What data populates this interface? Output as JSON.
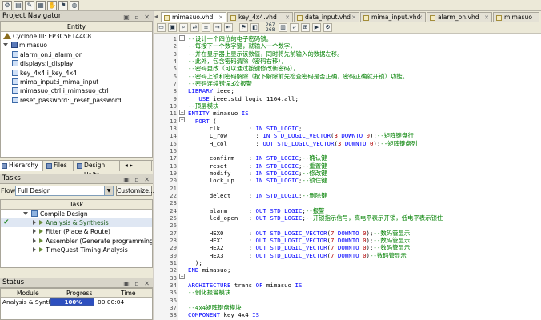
{
  "toolbar": {
    "buttons": [
      "gear-icon",
      "doc-icon",
      "note-icon",
      "grid-icon",
      "hand-icon",
      "flag-icon",
      "globe-icon"
    ]
  },
  "project_navigator": {
    "title": "Project Navigator",
    "column": "Entity",
    "device": "Cyclone III: EP3C5E144C8",
    "top_entity": "mimasuo",
    "instances": [
      "alarm_on:i_alarm_on",
      "displays:i_display",
      "key_4x4:i_key_4x4",
      "mima_input:i_mima_input",
      "mimasuo_ctrl:i_mimasuo_ctrl",
      "reset_password:i_reset_password"
    ],
    "tabs": [
      "Hierarchy",
      "Files",
      "Design Units"
    ]
  },
  "tasks": {
    "title": "Tasks",
    "flow_label": "Flow:",
    "flow_value": "Full Design",
    "customize_label": "Customize...",
    "column": "Task",
    "items": [
      {
        "label": "Compile Design",
        "level": 0,
        "status": ""
      },
      {
        "label": "Analysis & Synthesis",
        "level": 1,
        "status": "done"
      },
      {
        "label": "Fitter (Place & Route)",
        "level": 1,
        "status": ""
      },
      {
        "label": "Assembler (Generate programming files)",
        "level": 1,
        "status": ""
      },
      {
        "label": "TimeQuest Timing Analysis",
        "level": 1,
        "status": ""
      }
    ]
  },
  "status": {
    "title": "Status",
    "headers": [
      "Module",
      "Progress",
      "Time"
    ],
    "rows": [
      {
        "module": "Analysis & Synthesis",
        "progress": "100%",
        "progress_value": 100,
        "time": "00:00:04"
      }
    ]
  },
  "editor": {
    "tabs": [
      "mimasuo.vhd",
      "key_4x4.vhd",
      "data_input.vhd",
      "mima_input.vhd",
      "alarm_on.vhd",
      "mimasuo"
    ],
    "active_tab": 0,
    "line_col": "267\n268",
    "lines": [
      [
        [
          "cm",
          "--设计一个四位的电子密码锁。"
        ]
      ],
      [
        [
          "cm",
          "--每按下一个数字键，就输入一个数字，"
        ]
      ],
      [
        [
          "cm",
          "--并在显示器上显示该数值，同时将先前输入的数据左移。"
        ]
      ],
      [
        [
          "cm",
          "--此外，包含密码清除（密码右移），"
        ]
      ],
      [
        [
          "cm",
          "--密码更改（可以通过按键修改新密码），"
        ]
      ],
      [
        [
          "cm",
          "--密码上锁和密码解除（按下解除前先检查密码是否正确，密码正确就开锁）功能。"
        ]
      ],
      [
        [
          "cm",
          "--密码连续错误3次报警"
        ]
      ],
      [
        [
          "kw",
          "LIBRARY"
        ],
        [
          "tx",
          " ieee;"
        ]
      ],
      [
        [
          "tx",
          "   "
        ],
        [
          "kw",
          "USE"
        ],
        [
          "tx",
          " ieee.std_logic_1164.all;"
        ]
      ],
      [
        [
          "cm",
          "--顶层模块"
        ]
      ],
      [
        [
          "kw",
          "ENTITY"
        ],
        [
          "tx",
          " mimasuo "
        ],
        [
          "kw",
          "IS"
        ]
      ],
      [
        [
          "tx",
          "  "
        ],
        [
          "kw",
          "PORT"
        ],
        [
          "tx",
          " ("
        ]
      ],
      [
        [
          "tx",
          "      clk        : "
        ],
        [
          "kw",
          "IN STD_LOGIC"
        ],
        [
          "tx",
          ";"
        ]
      ],
      [
        [
          "tx",
          "      L_row        : "
        ],
        [
          "kw",
          "IN STD_LOGIC_VECTOR"
        ],
        [
          "tx",
          "("
        ],
        [
          "nm",
          "3"
        ],
        [
          "tx",
          " "
        ],
        [
          "kw",
          "DOWNTO"
        ],
        [
          "tx",
          " "
        ],
        [
          "nm",
          "0"
        ],
        [
          "tx",
          ");"
        ],
        [
          "cm",
          "--矩阵键盘行"
        ]
      ],
      [
        [
          "tx",
          "      H_col        : "
        ],
        [
          "kw",
          "OUT STD_LOGIC_VECTOR"
        ],
        [
          "tx",
          "("
        ],
        [
          "nm",
          "3"
        ],
        [
          "tx",
          " "
        ],
        [
          "kw",
          "DOWNTO"
        ],
        [
          "tx",
          " "
        ],
        [
          "nm",
          "0"
        ],
        [
          "tx",
          ");"
        ],
        [
          "cm",
          "--矩阵键盘列"
        ]
      ],
      [
        [
          "tx",
          ""
        ]
      ],
      [
        [
          "tx",
          "      confirm    : "
        ],
        [
          "kw",
          "IN STD_LOGIC"
        ],
        [
          "tx",
          ";"
        ],
        [
          "cm",
          "--确认键"
        ]
      ],
      [
        [
          "tx",
          "      reset      : "
        ],
        [
          "kw",
          "IN STD_LOGIC"
        ],
        [
          "tx",
          ";"
        ],
        [
          "cm",
          "--重置键"
        ]
      ],
      [
        [
          "tx",
          "      modify     : "
        ],
        [
          "kw",
          "IN STD_LOGIC"
        ],
        [
          "tx",
          ";"
        ],
        [
          "cm",
          "--修改键"
        ]
      ],
      [
        [
          "tx",
          "      lock_up    : "
        ],
        [
          "kw",
          "IN STD_LOGIC"
        ],
        [
          "tx",
          ";"
        ],
        [
          "cm",
          "--锁住键"
        ]
      ],
      [
        [
          "tx",
          ""
        ]
      ],
      [
        [
          "tx",
          "      delect     : "
        ],
        [
          "kw",
          "IN STD_LOGIC"
        ],
        [
          "tx",
          ";"
        ],
        [
          "cm",
          "--删除键"
        ]
      ],
      [
        [
          "cursor",
          "      "
        ]
      ],
      [
        [
          "tx",
          "      alarm      : "
        ],
        [
          "kw",
          "OUT STD_LOGIC"
        ],
        [
          "tx",
          ";"
        ],
        [
          "cm",
          "--报警"
        ]
      ],
      [
        [
          "tx",
          "      led_open   : "
        ],
        [
          "kw",
          "OUT STD_LOGIC"
        ],
        [
          "tx",
          ";"
        ],
        [
          "cm",
          "--开锁指示信号，高电平表示开锁，低电平表示锁住"
        ]
      ],
      [
        [
          "tx",
          ""
        ]
      ],
      [
        [
          "tx",
          "      HEX0       : "
        ],
        [
          "kw",
          "OUT STD_LOGIC_VECTOR"
        ],
        [
          "tx",
          "("
        ],
        [
          "nm",
          "7"
        ],
        [
          "tx",
          " "
        ],
        [
          "kw",
          "DOWNTO"
        ],
        [
          "tx",
          " "
        ],
        [
          "nm",
          "0"
        ],
        [
          "tx",
          ");"
        ],
        [
          "cm",
          "--数码管显示"
        ]
      ],
      [
        [
          "tx",
          "      HEX1       : "
        ],
        [
          "kw",
          "OUT STD_LOGIC_VECTOR"
        ],
        [
          "tx",
          "("
        ],
        [
          "nm",
          "7"
        ],
        [
          "tx",
          " "
        ],
        [
          "kw",
          "DOWNTO"
        ],
        [
          "tx",
          " "
        ],
        [
          "nm",
          "0"
        ],
        [
          "tx",
          ");"
        ],
        [
          "cm",
          "--数码管显示"
        ]
      ],
      [
        [
          "tx",
          "      HEX2       : "
        ],
        [
          "kw",
          "OUT STD_LOGIC_VECTOR"
        ],
        [
          "tx",
          "("
        ],
        [
          "nm",
          "7"
        ],
        [
          "tx",
          " "
        ],
        [
          "kw",
          "DOWNTO"
        ],
        [
          "tx",
          " "
        ],
        [
          "nm",
          "0"
        ],
        [
          "tx",
          ");"
        ],
        [
          "cm",
          "--数码管显示"
        ]
      ],
      [
        [
          "tx",
          "      HEX3       : "
        ],
        [
          "kw",
          "OUT STD_LOGIC_VECTOR"
        ],
        [
          "tx",
          "("
        ],
        [
          "nm",
          "7"
        ],
        [
          "tx",
          " "
        ],
        [
          "kw",
          "DOWNTO"
        ],
        [
          "tx",
          " "
        ],
        [
          "nm",
          "0"
        ],
        [
          "tx",
          ")"
        ],
        [
          "cm",
          "--数码管显示"
        ]
      ],
      [
        [
          "tx",
          "  );"
        ]
      ],
      [
        [
          "kw",
          "END"
        ],
        [
          "tx",
          " mimasuo;"
        ]
      ],
      [
        [
          "tx",
          ""
        ]
      ],
      [
        [
          "kw",
          "ARCHITECTURE"
        ],
        [
          "tx",
          " trans "
        ],
        [
          "kw",
          "OF"
        ],
        [
          "tx",
          " mimasuo "
        ],
        [
          "kw",
          "IS"
        ]
      ],
      [
        [
          "cm",
          "--例化报警模块"
        ]
      ],
      [
        [
          "tx",
          ""
        ]
      ],
      [
        [
          "cm",
          "--4x4矩阵键盘模块"
        ]
      ],
      [
        [
          "kw",
          "COMPONENT"
        ],
        [
          "tx",
          " key_4x4 "
        ],
        [
          "kw",
          "IS"
        ]
      ]
    ]
  }
}
